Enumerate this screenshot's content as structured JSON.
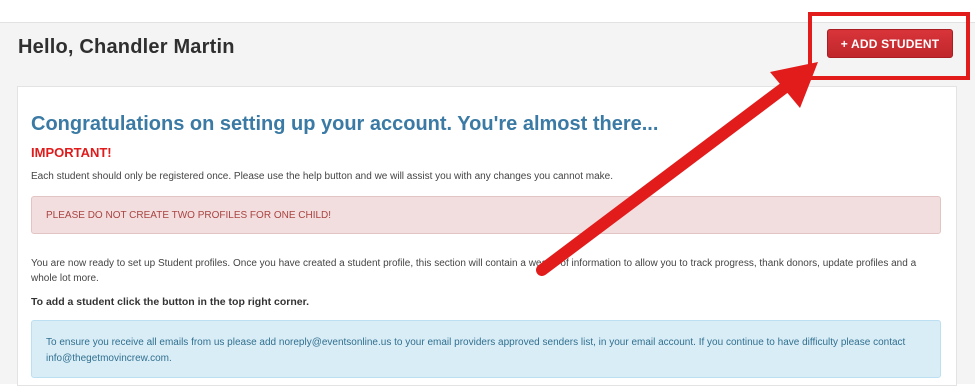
{
  "header": {
    "greeting": "Hello, Chandler Martin",
    "add_student_label": "+ ADD STUDENT"
  },
  "main": {
    "title": "Congratulations on setting up your account. You're almost there...",
    "important_label": "IMPORTANT!",
    "intro_text": "Each student should only be registered once. Please use the help button and we will assist you with any changes you cannot make.",
    "danger_alert": "PLEASE DO NOT CREATE TWO PROFILES FOR ONE CHILD!",
    "ready_text": "You are now ready to set up Student profiles. Once you have created a student profile, this section will contain a wealth of information to allow you to track progress, thank donors, update profiles and a whole lot more.",
    "add_instruction": "To add a student click the button in the top right corner.",
    "info_alert": "To ensure you receive all emails from us please add noreply@eventsonline.us to your email providers approved senders list, in your email account. If you continue to have difficulty please contact info@thegetmovincrew.com."
  },
  "colors": {
    "accent_red": "#c0262b",
    "annotation_red": "#e21b1b",
    "title_blue": "#3a7aa4",
    "danger_bg": "#f2dede",
    "info_bg": "#d9edf7"
  }
}
